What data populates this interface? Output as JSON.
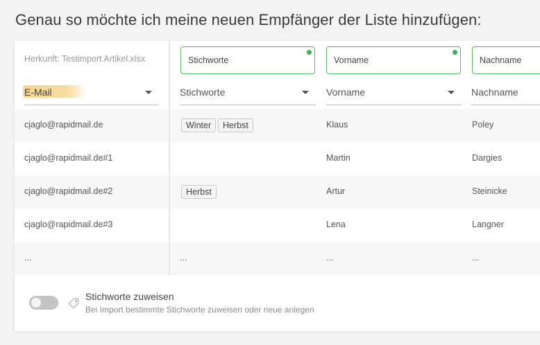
{
  "heading": "Genau so möchte ich meine neuen Empfänger der Liste hinzufügen:",
  "origin_label": "Herkunft: Testimport Artikel.xlsx",
  "colors": {
    "accent_green": "#3cb551",
    "field_border": "#5cb85c",
    "stripe": "#f7f7f7",
    "highlight": "#f6ce78"
  },
  "columns": [
    {
      "field_value": "",
      "select_label": "E-Mail"
    },
    {
      "field_value": "Stichworte",
      "select_label": "Stichworte"
    },
    {
      "field_value": "Vorname",
      "select_label": "Vorname"
    },
    {
      "field_value": "Nachname",
      "select_label": "Nachname"
    }
  ],
  "rows": [
    {
      "email": "cjaglo@rapidmail.de",
      "tags": [
        "Winter",
        "Herbst"
      ],
      "vorname": "Klaus",
      "nachname": "Poley"
    },
    {
      "email": "cjaglo@rapidmail.de#1",
      "tags": [],
      "vorname": "Martin",
      "nachname": "Dargies"
    },
    {
      "email": "cjaglo@rapidmail.de#2",
      "tags": [
        "Herbst"
      ],
      "vorname": "Artur",
      "nachname": "Steinicke"
    },
    {
      "email": "cjaglo@rapidmail.de#3",
      "tags": [],
      "vorname": "Lena",
      "nachname": "Langner"
    },
    {
      "email": "...",
      "tags_text": "...",
      "vorname": "...",
      "nachname": "..."
    }
  ],
  "footer": {
    "toggle_on": false,
    "title": "Stichworte zuweisen",
    "subtitle": "Bei Import bestimmte Stichworte zuweisen oder neue anlegen"
  },
  "icons": {
    "dropdown": "chevron-down-icon",
    "tag": "tag-icon"
  }
}
